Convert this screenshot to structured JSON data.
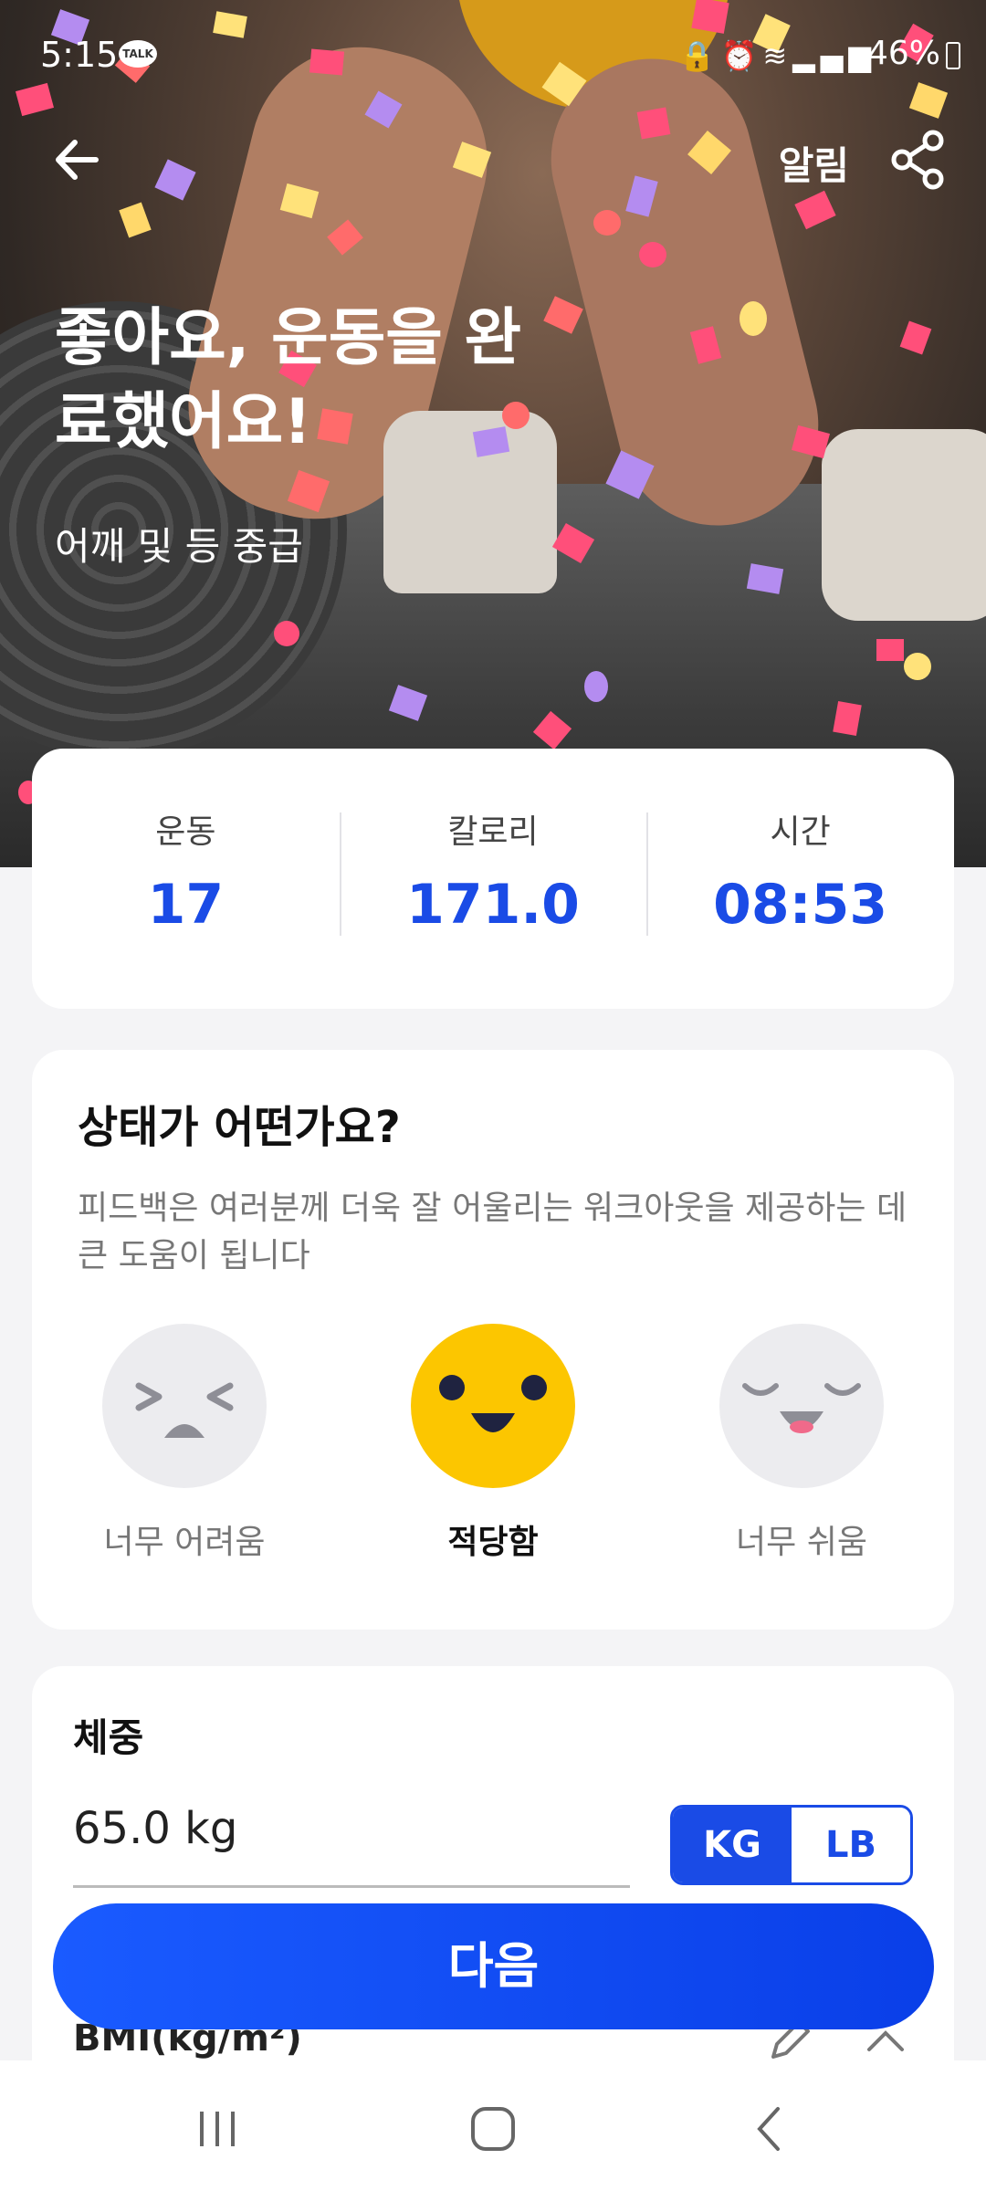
{
  "status_bar": {
    "time": "5:15",
    "talk_badge": "TALK",
    "icons": [
      "lock-icon",
      "alarm-icon",
      "wifi-icon",
      "signal-icon"
    ],
    "battery": "46%"
  },
  "top_bar": {
    "back_icon": "back-arrow-icon",
    "alarm_label": "알림",
    "share_icon": "share-icon"
  },
  "hero": {
    "title": "좋아요, 운동을 완료했어요!",
    "subtitle": "어깨 및 등 중급"
  },
  "stats": [
    {
      "label": "운동",
      "value": "17"
    },
    {
      "label": "칼로리",
      "value": "171.0"
    },
    {
      "label": "시간",
      "value": "08:53"
    }
  ],
  "feedback": {
    "question": "상태가 어떤가요?",
    "description": "피드백은 여러분께 더욱 잘 어울리는 워크아웃을 제공하는 데 큰 도움이 됩니다",
    "options": [
      {
        "label": "너무 어려움",
        "icon": "hard-face-icon",
        "selected": false
      },
      {
        "label": "적당함",
        "icon": "happy-face-icon",
        "selected": true
      },
      {
        "label": "너무 쉬움",
        "icon": "easy-face-icon",
        "selected": false
      }
    ]
  },
  "weight": {
    "title": "체중",
    "value": "65.0 kg",
    "unit_kg": "KG",
    "unit_lb": "LB",
    "selected_unit": "KG",
    "bmi_label": "BMI(kg/m²)"
  },
  "next_button": "다음",
  "colors": {
    "accent": "#1a4be6",
    "selected_face": "#fcc600",
    "background": "#f4f4f6"
  }
}
